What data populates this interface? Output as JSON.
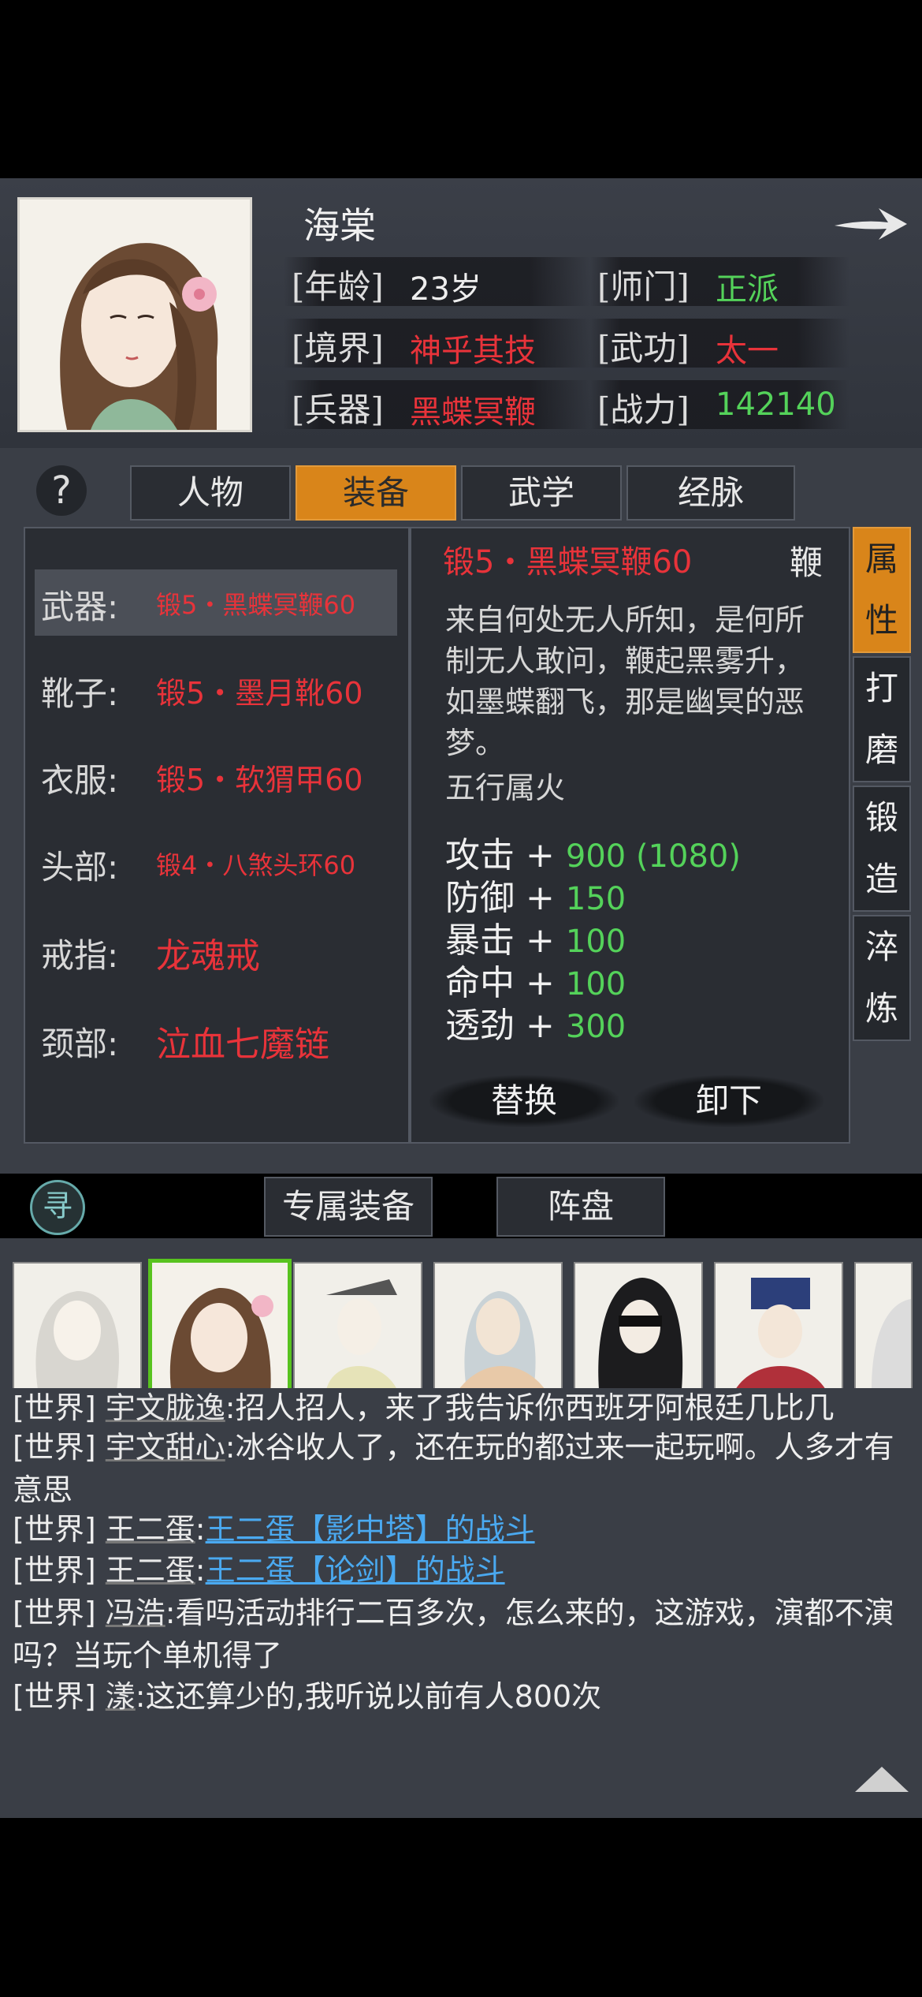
{
  "character": {
    "name": "海棠",
    "fields": [
      {
        "label": "[年龄]",
        "value": "23岁"
      },
      {
        "label": "[师门]",
        "value": "正派"
      },
      {
        "label": "[境界]",
        "value": "神乎其技"
      },
      {
        "label": "[武功]",
        "value": "太一"
      },
      {
        "label": "[兵器]",
        "value": "黑蝶冥鞭"
      },
      {
        "label": "[战力]",
        "value": "142140"
      }
    ],
    "colors": {
      "red": "#e8333a",
      "green": "#54d25a"
    }
  },
  "tabs": [
    "人物",
    "装备",
    "武学",
    "经脉"
  ],
  "active_tab": "装备",
  "help_label": "?",
  "equipment": [
    {
      "slot": "武器:",
      "item": "锻5・黑蝶冥鞭60"
    },
    {
      "slot": "靴子:",
      "item": "锻5・墨月靴60"
    },
    {
      "slot": "衣服:",
      "item": "锻5・软猬甲60"
    },
    {
      "slot": "头部:",
      "item": "锻4・八煞头环60"
    },
    {
      "slot": "戒指:",
      "item": "龙魂戒"
    },
    {
      "slot": "颈部:",
      "item": "泣血七魔链"
    }
  ],
  "detail": {
    "title": "锻5・黑蝶冥鞭60",
    "type": "鞭",
    "description": "来自何处无人所知，是何所制无人敢问，鞭起黑雾升，如墨蝶翻飞，那是幽冥的恶梦。",
    "element": "五行属火",
    "stats": [
      {
        "name": "攻击",
        "plus": "+",
        "value": "900 (1080)"
      },
      {
        "name": "防御",
        "plus": "+",
        "value": "150"
      },
      {
        "name": "暴击",
        "plus": "+",
        "value": "100"
      },
      {
        "name": "命中",
        "plus": "+",
        "value": "100"
      },
      {
        "name": "透劲",
        "plus": "+",
        "value": "300"
      }
    ],
    "buttons": {
      "replace": "替换",
      "remove": "卸下"
    }
  },
  "side_tabs": [
    "属性",
    "打磨",
    "锻造",
    "淬炼"
  ],
  "bottom_tabs": {
    "exclusive": "专属装备",
    "formation": "阵盘",
    "seek": "寻"
  },
  "chat": [
    {
      "channel": "[世界]",
      "user": "宇文胧逸",
      "text": ":招人招人，来了我告诉你西班牙阿根廷几比几"
    },
    {
      "channel": "[世界]",
      "user": "宇文甜心",
      "text": ":冰谷收人了，还在玩的都过来一起玩啊。人多才有意思"
    },
    {
      "channel": "[世界]",
      "user": "王二蛋",
      "text": ":",
      "link": "王二蛋【影中塔】的战斗"
    },
    {
      "channel": "[世界]",
      "user": "王二蛋",
      "text": ":",
      "link": "王二蛋【论剑】的战斗"
    },
    {
      "channel": "[世界]",
      "user": "冯浩",
      "text": ":看吗活动排行二百多次，怎么来的，这游戏，演都不演吗？当玩个单机得了"
    },
    {
      "channel": "[世界]",
      "user": "漾",
      "text": ":这还算少的,我听说以前有人800次"
    }
  ]
}
